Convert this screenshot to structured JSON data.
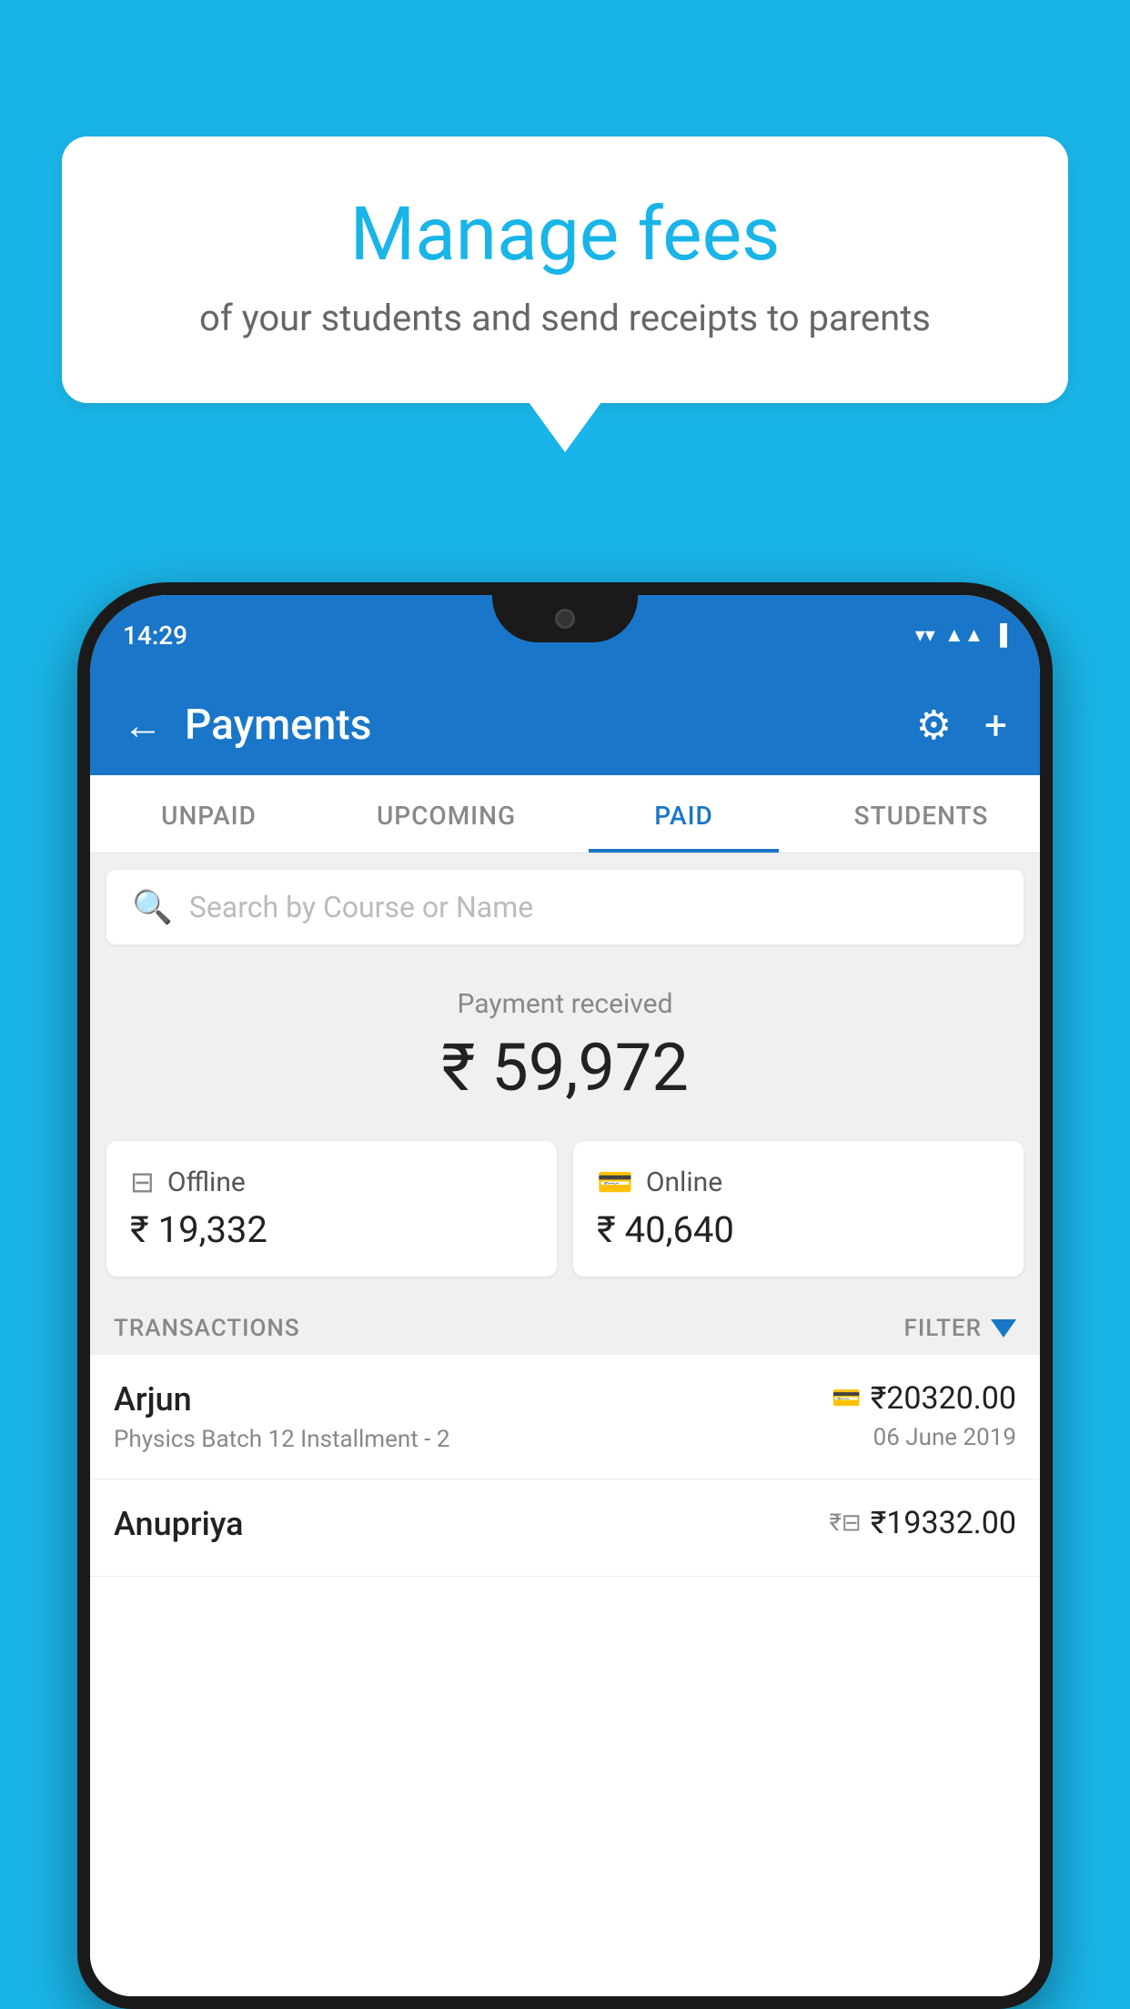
{
  "background_color": "#1ab5e8",
  "speech_bubble": {
    "title": "Manage fees",
    "subtitle": "of your students and send receipts to parents"
  },
  "phone": {
    "status_bar": {
      "time": "14:29",
      "icons": [
        "wifi",
        "signal",
        "battery"
      ]
    },
    "header": {
      "title": "Payments",
      "back_label": "←",
      "settings_label": "⚙",
      "add_label": "+"
    },
    "tabs": [
      {
        "label": "UNPAID",
        "active": false
      },
      {
        "label": "UPCOMING",
        "active": false
      },
      {
        "label": "PAID",
        "active": true
      },
      {
        "label": "STUDENTS",
        "active": false
      }
    ],
    "search": {
      "placeholder": "Search by Course or Name"
    },
    "payment_summary": {
      "label": "Payment received",
      "amount": "₹ 59,972",
      "offline": {
        "label": "Offline",
        "amount": "₹ 19,332"
      },
      "online": {
        "label": "Online",
        "amount": "₹ 40,640"
      }
    },
    "transactions": {
      "header_label": "TRANSACTIONS",
      "filter_label": "FILTER",
      "items": [
        {
          "name": "Arjun",
          "detail": "Physics Batch 12 Installment - 2",
          "amount": "₹20320.00",
          "date": "06 June 2019",
          "payment_type": "card"
        },
        {
          "name": "Anupriya",
          "detail": "",
          "amount": "₹19332.00",
          "date": "",
          "payment_type": "cash"
        }
      ]
    }
  }
}
